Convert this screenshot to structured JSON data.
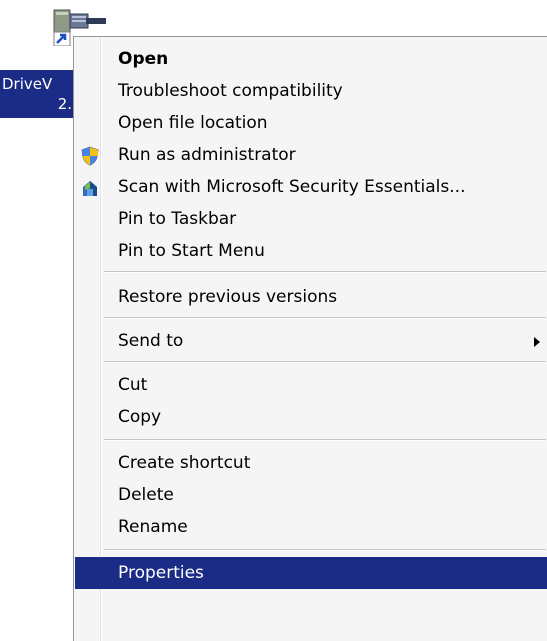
{
  "desktop_icon": {
    "name_line1": "DriveV",
    "name_line2": "2.",
    "icon": "application-shortcut-icon"
  },
  "context_menu": {
    "items": [
      {
        "label": "Open",
        "bold": true
      },
      {
        "label": "Troubleshoot compatibility"
      },
      {
        "label": "Open file location"
      },
      {
        "label": "Run as administrator",
        "icon": "uac-shield-icon"
      },
      {
        "label": "Scan with Microsoft Security Essentials...",
        "icon": "security-essentials-icon"
      },
      {
        "label": "Pin to Taskbar"
      },
      {
        "label": "Pin to Start Menu"
      },
      {
        "label": "Restore previous versions"
      },
      {
        "label": "Send to",
        "submenu": true
      },
      {
        "label": "Cut"
      },
      {
        "label": "Copy"
      },
      {
        "label": "Create shortcut"
      },
      {
        "label": "Delete"
      },
      {
        "label": "Rename"
      },
      {
        "label": "Properties",
        "selected": true
      }
    ]
  },
  "colors": {
    "selection": "#1b2c86",
    "menu_background": "#f5f5f5"
  }
}
